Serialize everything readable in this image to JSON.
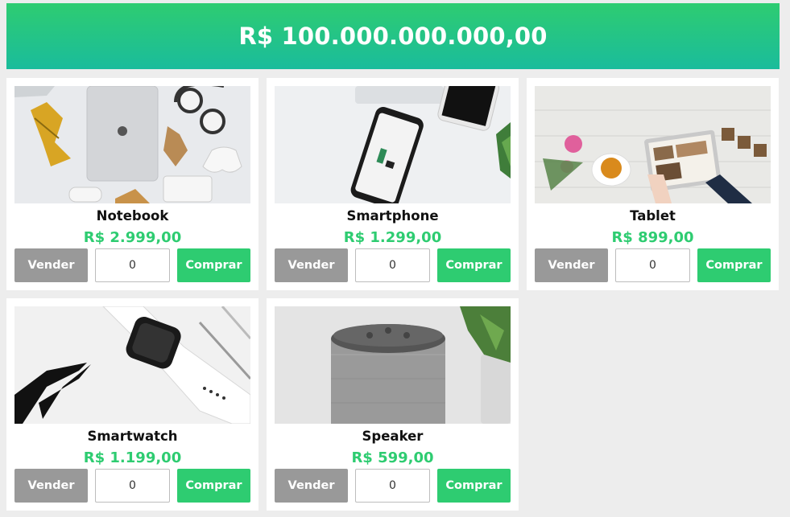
{
  "header": {
    "balance": "R$ 100.000.000.000,00",
    "gradient_top": "#2ecc71",
    "gradient_bottom": "#1abc9c"
  },
  "colors": {
    "page_background": "#ededed",
    "price": "#2ecc71",
    "sell_button": "#999999",
    "buy_button": "#2ecc71"
  },
  "products": [
    {
      "name": "Notebook",
      "price": "R$ 2.999,00",
      "quantity": "0",
      "sell_label": "Vender",
      "buy_label": "Comprar",
      "image_icon": "notebook-photo-icon"
    },
    {
      "name": "Smartphone",
      "price": "R$ 1.299,00",
      "quantity": "0",
      "sell_label": "Vender",
      "buy_label": "Comprar",
      "image_icon": "smartphone-photo-icon"
    },
    {
      "name": "Tablet",
      "price": "R$ 899,00",
      "quantity": "0",
      "sell_label": "Vender",
      "buy_label": "Comprar",
      "image_icon": "tablet-photo-icon"
    },
    {
      "name": "Smartwatch",
      "price": "R$ 1.199,00",
      "quantity": "0",
      "sell_label": "Vender",
      "buy_label": "Comprar",
      "image_icon": "smartwatch-photo-icon"
    },
    {
      "name": "Speaker",
      "price": "R$ 599,00",
      "quantity": "0",
      "sell_label": "Vender",
      "buy_label": "Comprar",
      "image_icon": "speaker-photo-icon"
    }
  ]
}
